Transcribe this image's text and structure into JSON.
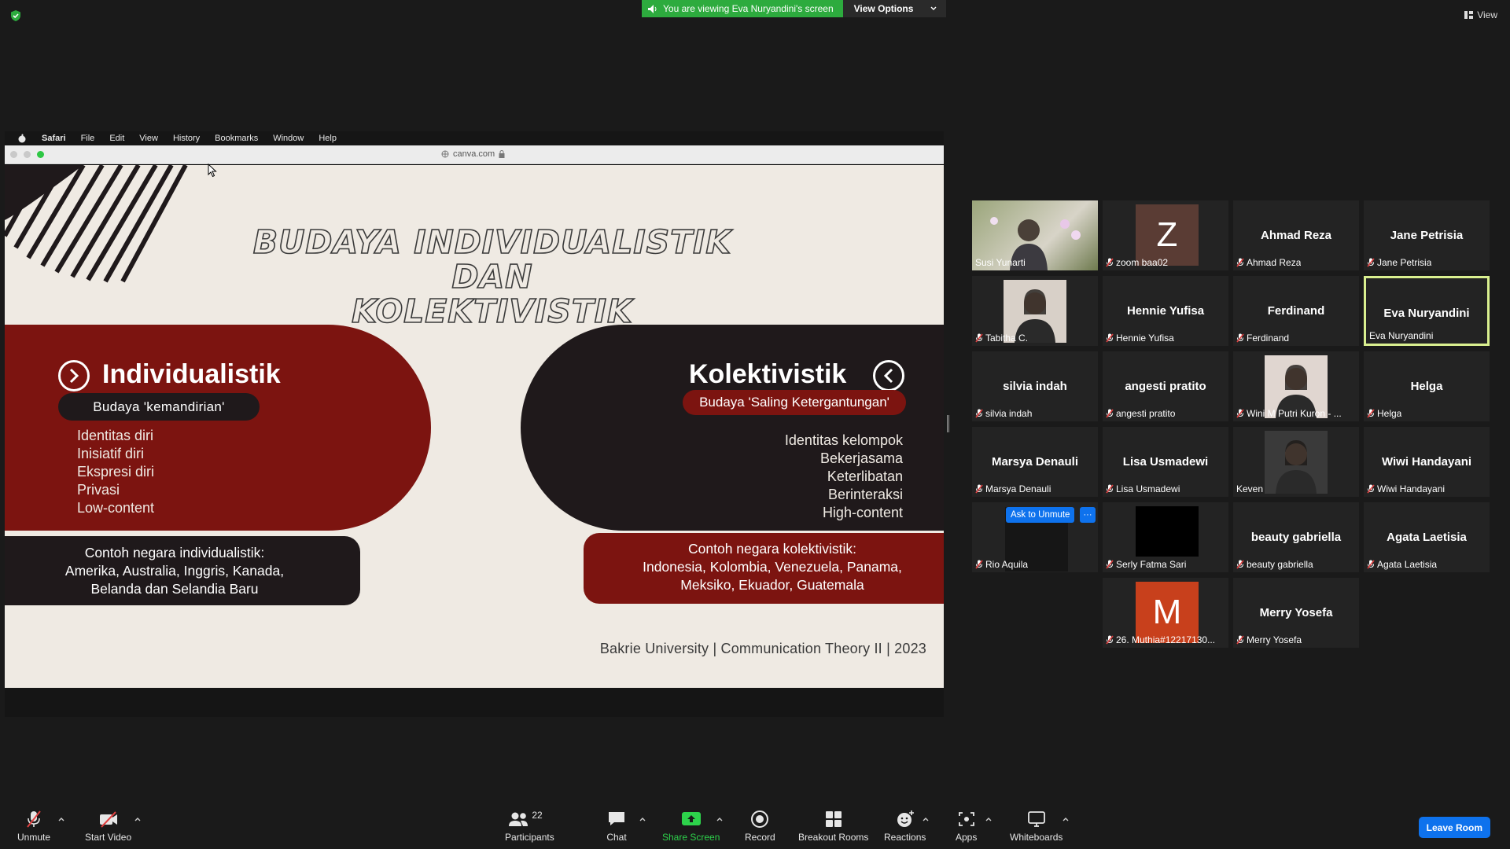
{
  "top": {
    "viewing_text": "You are viewing Eva Nuryandini's screen",
    "view_options": "View Options",
    "view_label": "View"
  },
  "shared": {
    "menubar": [
      "Safari",
      "File",
      "Edit",
      "View",
      "History",
      "Bookmarks",
      "Window",
      "Help"
    ],
    "url": "canva.com",
    "slide": {
      "title_line1": "BUDAYA INDIVIDUALISTIK DAN",
      "title_line2": "KOLEKTIVISTIK",
      "left_heading": "Individualistik",
      "left_sub": "Budaya 'kemandirian'",
      "left_items": [
        "Identitas diri",
        "Inisiatif  diri",
        "Ekspresi diri",
        "Privasi",
        "Low-content"
      ],
      "left_box": [
        "Contoh negara individualistik:",
        "Amerika, Australia, Inggris, Kanada,",
        "Belanda dan Selandia Baru"
      ],
      "right_heading": "Kolektivistik",
      "right_sub": "Budaya 'Saling Ketergantungan'",
      "right_items": [
        "Identitas kelompok",
        "Bekerjasama",
        "Keterlibatan",
        "Berinteraksi",
        "High-content"
      ],
      "right_box": [
        "Contoh negara kolektivistik:",
        "Indonesia, Kolombia, Venezuela, Panama,",
        "Meksiko, Ekuador, Guatemala"
      ],
      "footer": "Bakrie University | Communication Theory II | 2023"
    }
  },
  "participants": [
    {
      "big": "",
      "small": "Susi Yunarti",
      "muted": false,
      "kind": "photo"
    },
    {
      "big": "Z",
      "small": "zoom baa02",
      "muted": true,
      "kind": "letter",
      "color": "#5a3c34"
    },
    {
      "big": "Ahmad Reza",
      "small": "Ahmad Reza",
      "muted": true,
      "kind": "name"
    },
    {
      "big": "Jane Petrisia",
      "small": "Jane Petrisia",
      "muted": true,
      "kind": "name"
    },
    {
      "big": "",
      "small": "Tabitha C.",
      "muted": true,
      "kind": "photo"
    },
    {
      "big": "Hennie Yufisa",
      "small": "Hennie Yufisa",
      "muted": true,
      "kind": "name"
    },
    {
      "big": "Ferdinand",
      "small": "Ferdinand",
      "muted": true,
      "kind": "name"
    },
    {
      "big": "Eva Nuryandini",
      "small": "Eva Nuryandini",
      "muted": false,
      "kind": "name",
      "active": true
    },
    {
      "big": "silvia indah",
      "small": "silvia indah",
      "muted": true,
      "kind": "name"
    },
    {
      "big": "angesti pratito",
      "small": "angesti pratito",
      "muted": true,
      "kind": "name"
    },
    {
      "big": "",
      "small": "Wini M Putri Kuron - ...",
      "muted": true,
      "kind": "photo"
    },
    {
      "big": "Helga",
      "small": "Helga",
      "muted": true,
      "kind": "name"
    },
    {
      "big": "Marsya Denauli",
      "small": "Marsya Denauli",
      "muted": true,
      "kind": "name"
    },
    {
      "big": "Lisa Usmadewi",
      "small": "Lisa Usmadewi",
      "muted": true,
      "kind": "name"
    },
    {
      "big": "",
      "small": "Keven",
      "muted": false,
      "kind": "photo"
    },
    {
      "big": "Wiwi Handayani",
      "small": "Wiwi Handayani",
      "muted": true,
      "kind": "name"
    },
    {
      "big": "",
      "small": "Rio Aquila",
      "muted": true,
      "kind": "video-dark",
      "hover": true
    },
    {
      "big": "",
      "small": "Serly Fatma Sari",
      "muted": true,
      "kind": "video-black"
    },
    {
      "big": "beauty gabriella",
      "small": "beauty gabriella",
      "muted": true,
      "kind": "name"
    },
    {
      "big": "Agata Laetisia",
      "small": "Agata Laetisia",
      "muted": true,
      "kind": "name"
    },
    {
      "big": "M",
      "small": "26. Muthia#12217130...",
      "muted": true,
      "kind": "letter",
      "color": "#c8401c"
    },
    {
      "big": "Merry Yosefa",
      "small": "Merry Yosefa",
      "muted": true,
      "kind": "name"
    }
  ],
  "hover_menu": {
    "ask_unmute": "Ask to Unmute",
    "more": "···"
  },
  "toolbar": {
    "unmute": "Unmute",
    "start_video": "Start Video",
    "participants": "Participants",
    "participant_count": "22",
    "chat": "Chat",
    "share_screen": "Share Screen",
    "record": "Record",
    "breakout": "Breakout Rooms",
    "reactions": "Reactions",
    "apps": "Apps",
    "whiteboards": "Whiteboards",
    "leave": "Leave Room"
  },
  "colors": {
    "accent_green": "#2dab3e",
    "zoom_blue": "#0e72ed",
    "slide_red": "#7c1410",
    "slide_dark": "#1f191b",
    "active_border": "#d9ef8f"
  }
}
